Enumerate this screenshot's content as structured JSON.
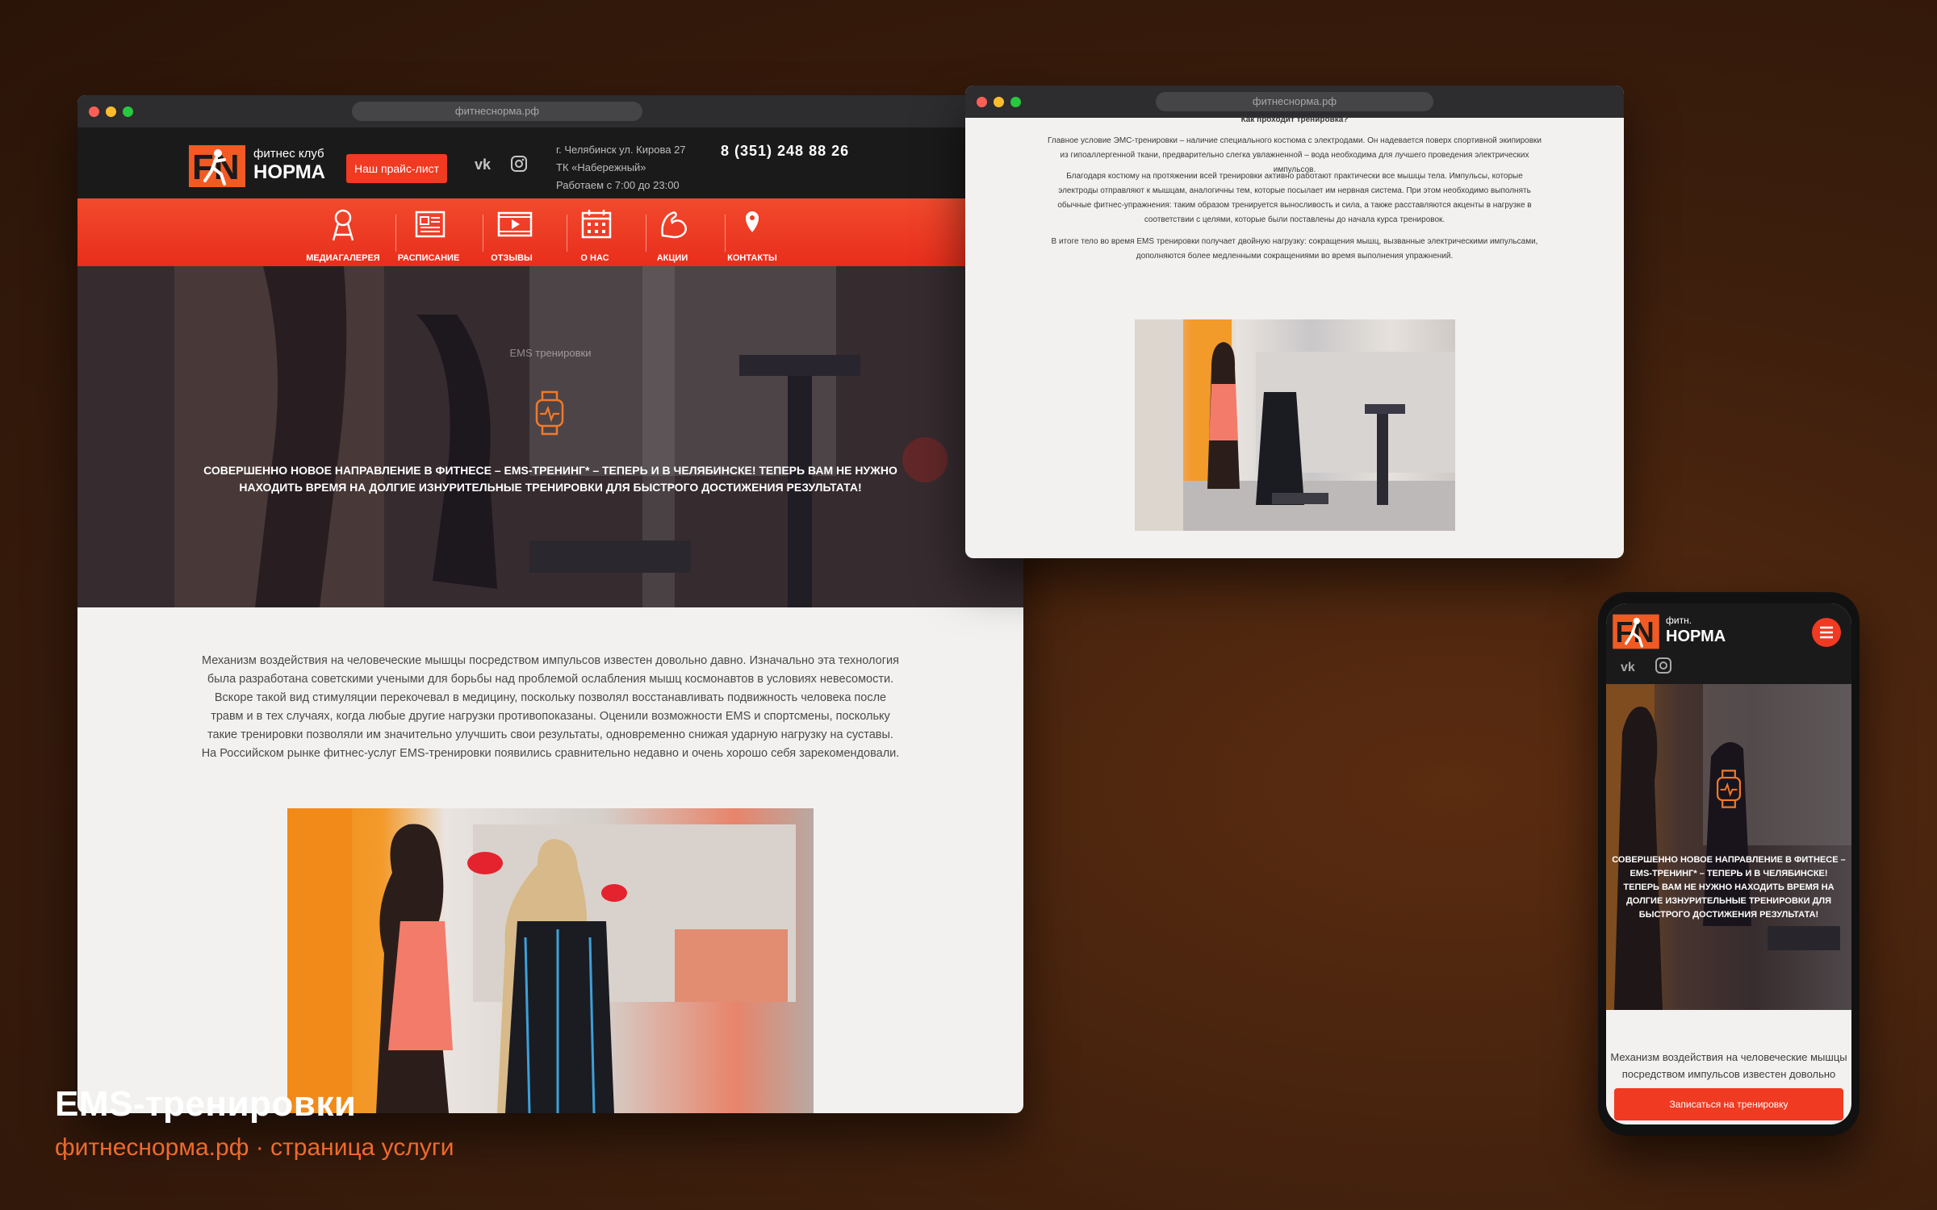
{
  "colors": {
    "accent": "#f03a22",
    "header": "#1b1a1a",
    "page_bg": "#f2f1f0"
  },
  "browser_main": {
    "url": "фитнеснорма.рф",
    "header": {
      "brand_small": "фитнес клуб",
      "brand_big": "НОРМА",
      "price_button": "Наш прайс-лист",
      "social": {
        "vk": "vk-icon",
        "instagram": "instagram-icon"
      },
      "address_line1": "г. Челябинск ул. Кирова 27",
      "address_line2": "ТК «Набережный»",
      "hours": "Работаем с 7:00 до 23:00",
      "phone": "8 (351) 248 88 26"
    },
    "nav": [
      {
        "label": "МЕДИАГАЛЕРЕЯ",
        "icon": "gallery-icon"
      },
      {
        "label": "РАСПИСАНИЕ",
        "icon": "schedule-icon"
      },
      {
        "label": "ОТЗЫВЫ",
        "icon": "video-icon"
      },
      {
        "label": "О НАС",
        "icon": "calendar-icon"
      },
      {
        "label": "АКЦИИ",
        "icon": "muscle-icon"
      },
      {
        "label": "КОНТАКТЫ",
        "icon": "location-icon"
      }
    ],
    "hero": {
      "label": "EMS тренировки",
      "text": "СОВЕРШЕННО НОВОЕ НАПРАВЛЕНИЕ В ФИТНЕСЕ – EMS-ТРЕНИНГ* – ТЕПЕРЬ И В ЧЕЛЯБИНСКЕ! ТЕПЕРЬ ВАМ НЕ НУЖНО НАХОДИТЬ ВРЕМЯ НА ДОЛГИЕ ИЗНУРИТЕЛЬНЫЕ ТРЕНИРОВКИ ДЛЯ БЫСТРОГО ДОСТИЖЕНИЯ РЕЗУЛЬТАТА!"
    },
    "body_text": "Механизм воздействия на человеческие мышцы посредством импульсов известен довольно давно. Изначально эта технология была разработана советскими учеными для борьбы над проблемой ослабления мышц космонавтов в условиях невесомости. Вскоре такой вид стимуляции перекочевал в медицину, поскольку позволял восстанавливать подвижность человека после травм и в тех случаях, когда любые другие нагрузки противопоказаны. Оценили возможности EMS и спортсмены, поскольку такие тренировки позволяли им значительно улучшить свои результаты, одновременно снижая ударную нагрузку на суставы. На Российском рынке фитнес-услуг EMS-тренировки появились сравнительно недавно и очень хорошо себя зарекомендовали."
  },
  "browser_second": {
    "url": "фитнеснорма.рф",
    "heading": "Как проходит тренировка?",
    "p1": "Главное условие ЭМС-тренировки – наличие специального костюма с электродами. Он надевается поверх спортивной экипировки из гипоаллергенной ткани, предварительно слегка увлажненной – вода необходима для лучшего проведения электрических импульсов.",
    "p2": "Благодаря костюму на протяжении всей тренировки активно работают практически все мышцы тела. Импульсы, которые электроды отправляют к мышцам, аналогичны тем, которые посылает им нервная система. При этом необходимо выполнять обычные фитнес-упражнения: таким образом тренируется выносливость и сила, а также расставляются акценты в нагрузке в соответствии с целями, которые были поставлены до начала курса тренировок.",
    "p3": "В итоге тело во время EMS тренировки получает двойную нагрузку: сокращения мышц, вызванные электрическими импульсами, дополняются более медленными сокращениями во время выполнения упражнений."
  },
  "phone": {
    "brand_small": "фитн.",
    "brand_big": "НОРМА",
    "hero_text": "СОВЕРШЕННО НОВОЕ НАПРАВЛЕНИЕ В ФИТНЕСЕ – EMS-ТРЕНИНГ* – ТЕПЕРЬ И В ЧЕЛЯБИНСКЕ! ТЕПЕРЬ ВАМ НЕ НУЖНО НАХОДИТЬ ВРЕМЯ НА ДОЛГИЕ ИЗНУРИТЕЛЬНЫЕ ТРЕНИРОВКИ ДЛЯ БЫСТРОГО ДОСТИЖЕНИЯ РЕЗУЛЬТАТА!",
    "body_text": "Механизм воздействия на человеческие мышцы посредством импульсов известен довольно",
    "cta": "Записаться на тренировку"
  },
  "caption": {
    "title": "EMS-тренировки",
    "subtitle": "фитнеснорма.рф · страница услуги"
  }
}
